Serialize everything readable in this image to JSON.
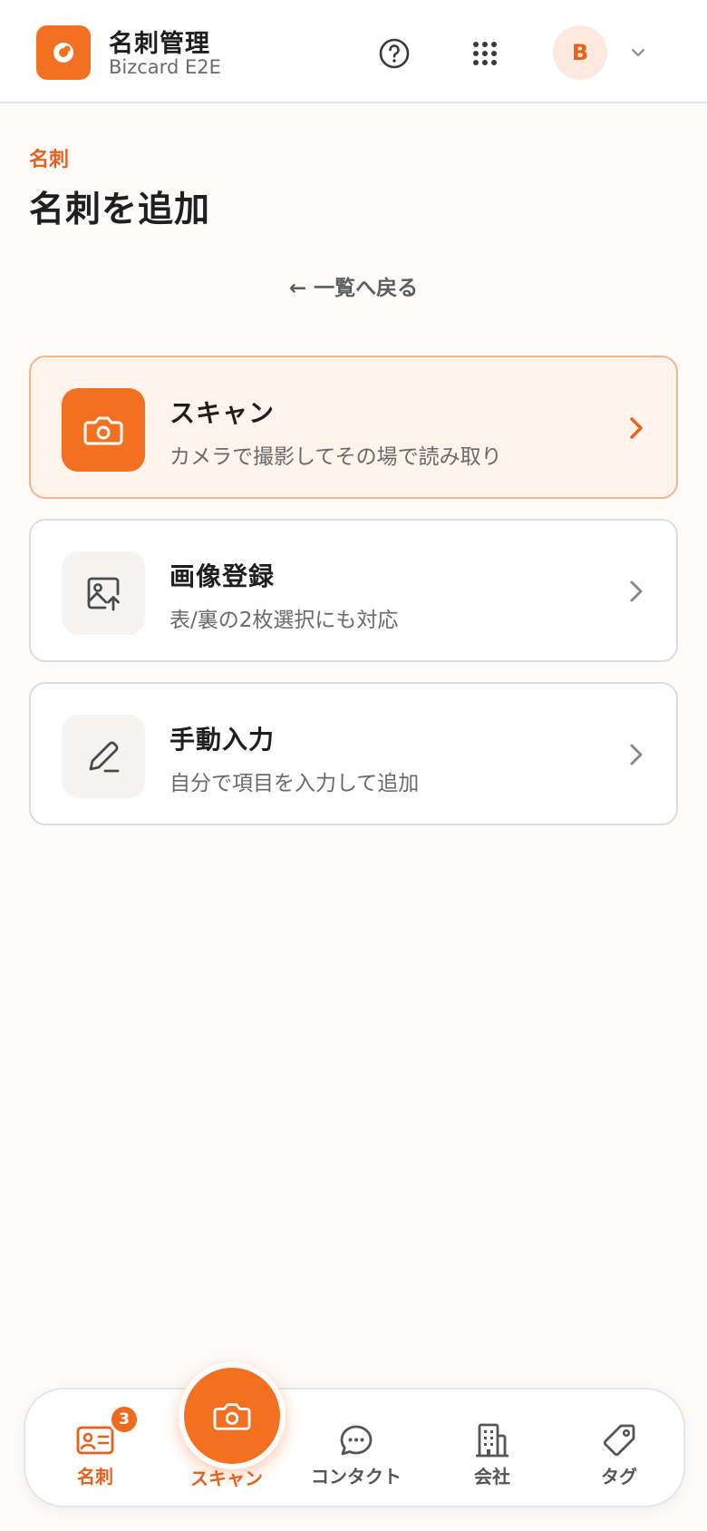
{
  "header": {
    "app_title": "名刺管理",
    "app_subtitle": "Bizcard E2E",
    "avatar_initial": "B"
  },
  "page": {
    "eyebrow": "名刺",
    "title": "名刺を追加",
    "back_link": "← 一覧へ戻る"
  },
  "options": [
    {
      "title": "スキャン",
      "description": "カメラで撮影してその場で読み取り",
      "icon": "camera-icon",
      "active": true
    },
    {
      "title": "画像登録",
      "description": "表/裏の2枚選択にも対応",
      "icon": "image-upload-icon",
      "active": false
    },
    {
      "title": "手動入力",
      "description": "自分で項目を入力して追加",
      "icon": "pencil-icon",
      "active": false
    }
  ],
  "bottom_nav": {
    "items": [
      {
        "label": "名刺",
        "icon": "card-icon",
        "badge": "3",
        "active": true
      },
      {
        "label": "スキャン",
        "icon": "camera-icon",
        "active": false
      },
      {
        "label": "コンタクト",
        "icon": "chat-icon",
        "active": false
      },
      {
        "label": "会社",
        "icon": "building-icon",
        "active": false
      },
      {
        "label": "タグ",
        "icon": "tag-icon",
        "active": false
      }
    ]
  },
  "colors": {
    "accent": "#F47021",
    "accent_text": "#E8601A",
    "background": "#FCFBFA",
    "active_card_bg": "#FFF3EB"
  }
}
